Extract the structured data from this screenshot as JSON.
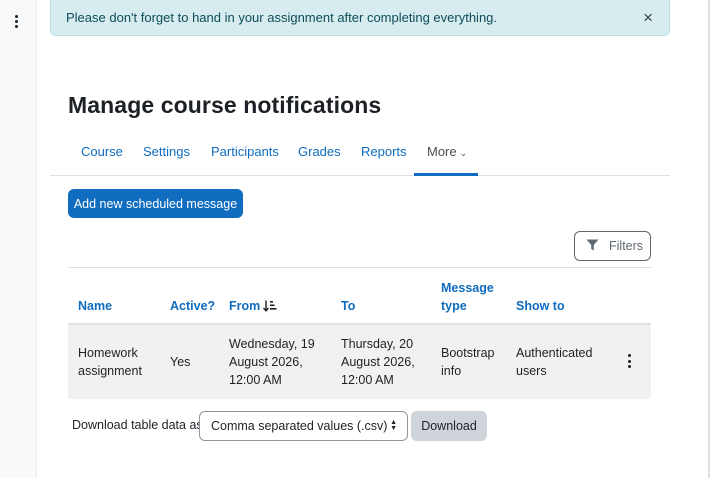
{
  "alert": {
    "message": "Please don't forget to hand in your assignment after completing everything.",
    "close_label": "×"
  },
  "page": {
    "title": "Manage course notifications"
  },
  "tabs": [
    {
      "label": "Course"
    },
    {
      "label": "Settings"
    },
    {
      "label": "Participants"
    },
    {
      "label": "Grades"
    },
    {
      "label": "Reports"
    },
    {
      "label": "More",
      "active": true
    }
  ],
  "actions": {
    "add_label": "Add new scheduled message",
    "filters_label": "Filters"
  },
  "table": {
    "headers": {
      "name": "Name",
      "active": "Active?",
      "from": "From",
      "to": "To",
      "message_type_line1": "Message",
      "message_type_line2": "type",
      "show_to": "Show to"
    },
    "rows": [
      {
        "name_line1": "Homework",
        "name_line2": "assignment",
        "active": "Yes",
        "from_line1": "Wednesday, 19",
        "from_line2": "August 2026,",
        "from_line3": "12:00 AM",
        "to_line1": "Thursday, 20",
        "to_line2": "August 2026,",
        "to_line3": "12:00 AM",
        "type_line1": "Bootstrap",
        "type_line2": "info",
        "show_line1": "Authenticated",
        "show_line2": "users"
      }
    ]
  },
  "download": {
    "label": "Download table data as",
    "selected_format": "Comma separated values (.csv)",
    "button_label": "Download"
  },
  "colors": {
    "primary": "#0f6cbf",
    "alert_bg": "#d6ecef",
    "alert_text": "#0e4d5a",
    "row_bg": "#f1f1f1"
  }
}
